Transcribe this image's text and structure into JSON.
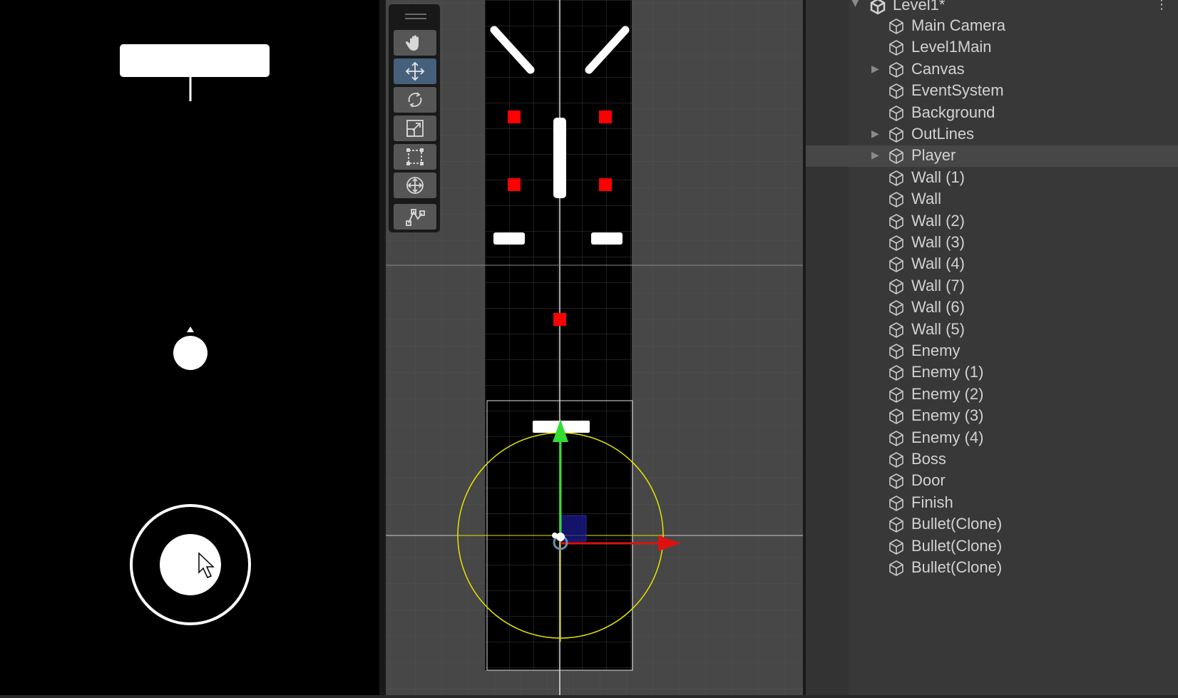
{
  "colors": {
    "game_bg": "#000000",
    "scene_bg": "#474747",
    "hierarchy_bg": "#383838",
    "enemy_red": "#ff0000",
    "gizmo_yellow": "#ffff00",
    "axis_green": "#22cc22",
    "axis_red": "#dd1111",
    "tool_active": "#46607c"
  },
  "scene_tools": [
    {
      "name": "hand-tool",
      "icon": "hand-icon",
      "active": false
    },
    {
      "name": "move-tool",
      "icon": "move-arrows-icon",
      "active": true
    },
    {
      "name": "rotate-tool",
      "icon": "rotate-icon",
      "active": false
    },
    {
      "name": "scale-tool",
      "icon": "scale-icon",
      "active": false
    },
    {
      "name": "rect-tool",
      "icon": "rect-icon",
      "active": false
    },
    {
      "name": "transform-tool",
      "icon": "transform-icon",
      "active": false
    },
    {
      "name": "custom-tool",
      "icon": "path-icon",
      "active": false
    }
  ],
  "hierarchy": {
    "root": "Level1*",
    "items": [
      {
        "label": "Main Camera",
        "expandable": false,
        "selected": false
      },
      {
        "label": "Level1Main",
        "expandable": false,
        "selected": false
      },
      {
        "label": "Canvas",
        "expandable": true,
        "selected": false
      },
      {
        "label": "EventSystem",
        "expandable": false,
        "selected": false
      },
      {
        "label": "Background",
        "expandable": false,
        "selected": false
      },
      {
        "label": "OutLines",
        "expandable": true,
        "selected": false
      },
      {
        "label": "Player",
        "expandable": true,
        "selected": true
      },
      {
        "label": "Wall (1)",
        "expandable": false,
        "selected": false
      },
      {
        "label": "Wall",
        "expandable": false,
        "selected": false
      },
      {
        "label": "Wall (2)",
        "expandable": false,
        "selected": false
      },
      {
        "label": "Wall (3)",
        "expandable": false,
        "selected": false
      },
      {
        "label": "Wall (4)",
        "expandable": false,
        "selected": false
      },
      {
        "label": "Wall (7)",
        "expandable": false,
        "selected": false
      },
      {
        "label": "Wall (6)",
        "expandable": false,
        "selected": false
      },
      {
        "label": "Wall (5)",
        "expandable": false,
        "selected": false
      },
      {
        "label": "Enemy",
        "expandable": false,
        "selected": false
      },
      {
        "label": "Enemy (1)",
        "expandable": false,
        "selected": false
      },
      {
        "label": "Enemy (2)",
        "expandable": false,
        "selected": false
      },
      {
        "label": "Enemy (3)",
        "expandable": false,
        "selected": false
      },
      {
        "label": "Enemy (4)",
        "expandable": false,
        "selected": false
      },
      {
        "label": "Boss",
        "expandable": false,
        "selected": false
      },
      {
        "label": "Door",
        "expandable": false,
        "selected": false
      },
      {
        "label": "Finish",
        "expandable": false,
        "selected": false
      },
      {
        "label": "Bullet(Clone)",
        "expandable": false,
        "selected": false
      },
      {
        "label": "Bullet(Clone)",
        "expandable": false,
        "selected": false
      },
      {
        "label": "Bullet(Clone)",
        "expandable": false,
        "selected": false
      }
    ]
  }
}
